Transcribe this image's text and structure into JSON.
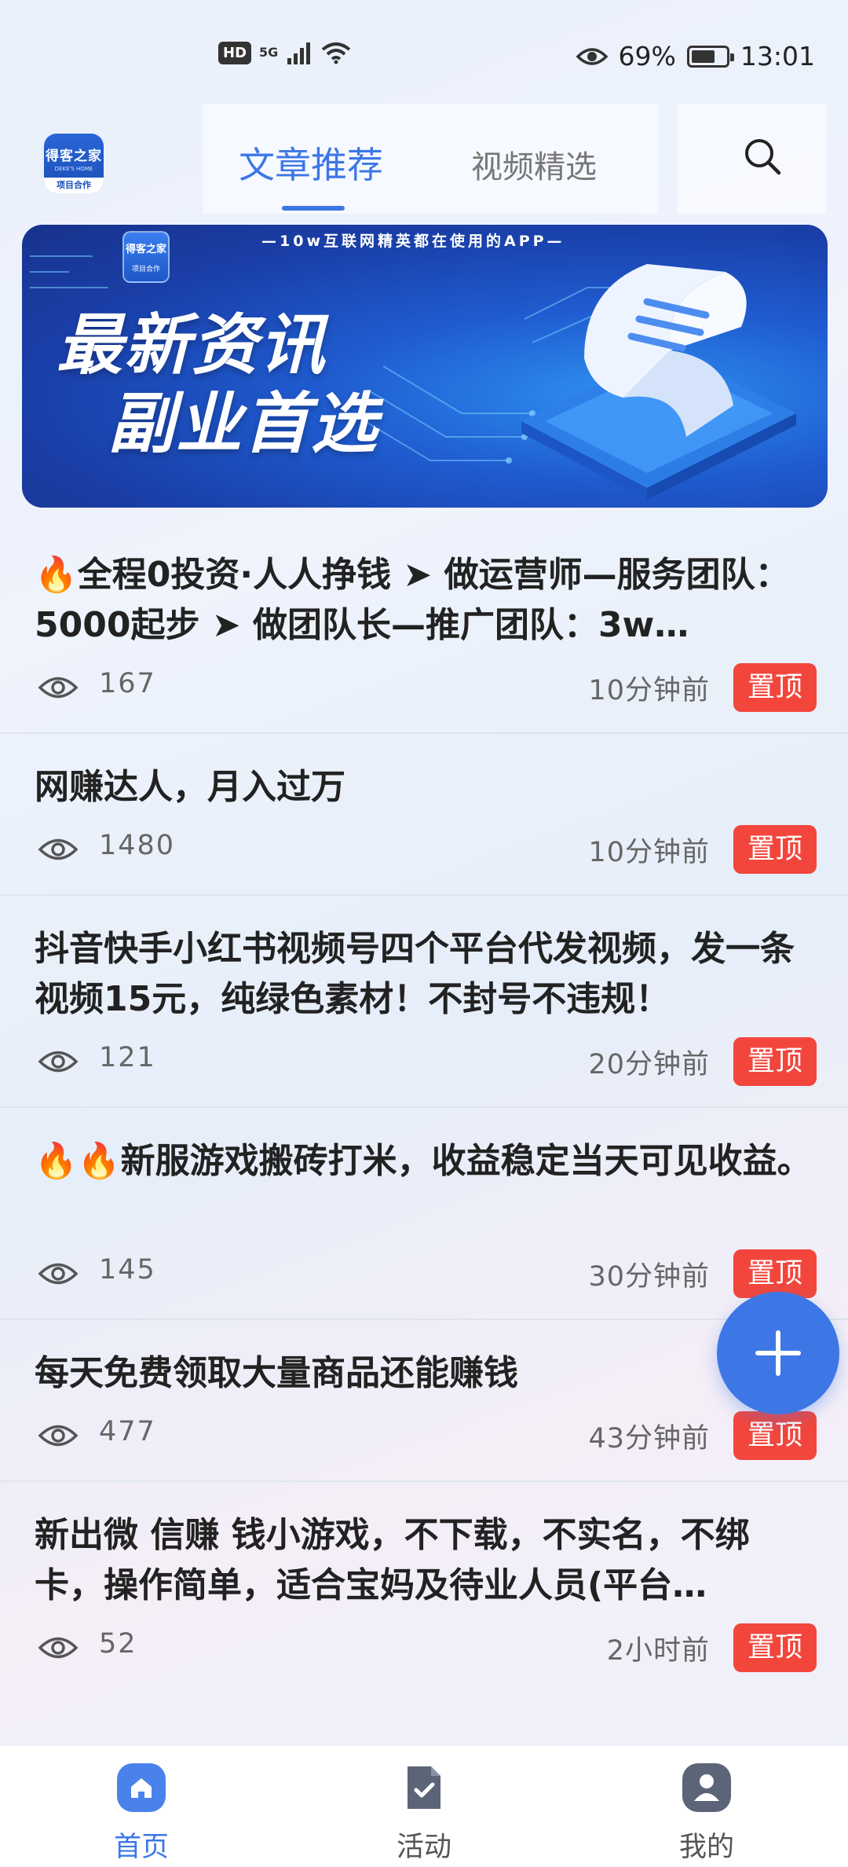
{
  "status_bar": {
    "hd": "HD",
    "network": "5G",
    "battery": "69%",
    "battery_level": 0.69,
    "time": "13:01"
  },
  "header": {
    "logo": {
      "top": "得客之家",
      "middle": "DEKE'S HOME",
      "bottom": "项目合作"
    },
    "tabs": [
      {
        "label": "文章推荐",
        "active": true
      },
      {
        "label": "视频精选",
        "active": false
      }
    ],
    "search_icon": "search-icon",
    "accent_color": "#3d77e6"
  },
  "banner": {
    "logo": {
      "top": "得客之家",
      "bottom": "项目合作"
    },
    "tagline": "—10w互联网精英都在使用的APP—",
    "headline_1": "最新资讯",
    "headline_2": "副业首选"
  },
  "articles": [
    {
      "title": "🔥全程0投资·人人挣钱 ➤ 做运营师—服务团队：5000起步 ➤ 做团队长—推广团队：3w…",
      "views": "167",
      "time": "10分钟前",
      "badge": "置顶"
    },
    {
      "title": "网赚达人，月入过万",
      "views": "1480",
      "time": "10分钟前",
      "badge": "置顶"
    },
    {
      "title": "抖音快手小红书视频号四个平台代发视频，发一条视频15元，纯绿色素材！不封号不违规！",
      "views": "121",
      "time": "20分钟前",
      "badge": "置顶"
    },
    {
      "title": "🔥🔥新服游戏搬砖打米，收益稳定当天可见收益。",
      "views": "145",
      "time": "30分钟前",
      "badge": "置顶"
    },
    {
      "title": "每天免费领取大量商品还能赚钱",
      "views": "477",
      "time": "43分钟前",
      "badge": "置顶"
    },
    {
      "title": "新出微 信赚 钱小游戏，不下载，不实名，不绑卡，操作简单，适合宝妈及待业人员(平台…",
      "views": "52",
      "time": "2小时前",
      "badge": "置顶"
    }
  ],
  "badge_color": "#f2463d",
  "fab": {
    "icon": "plus-icon"
  },
  "bottom_nav": [
    {
      "label": "首页",
      "icon": "home-icon",
      "active": true
    },
    {
      "label": "活动",
      "icon": "activity-icon",
      "active": false
    },
    {
      "label": "我的",
      "icon": "profile-icon",
      "active": false
    }
  ]
}
